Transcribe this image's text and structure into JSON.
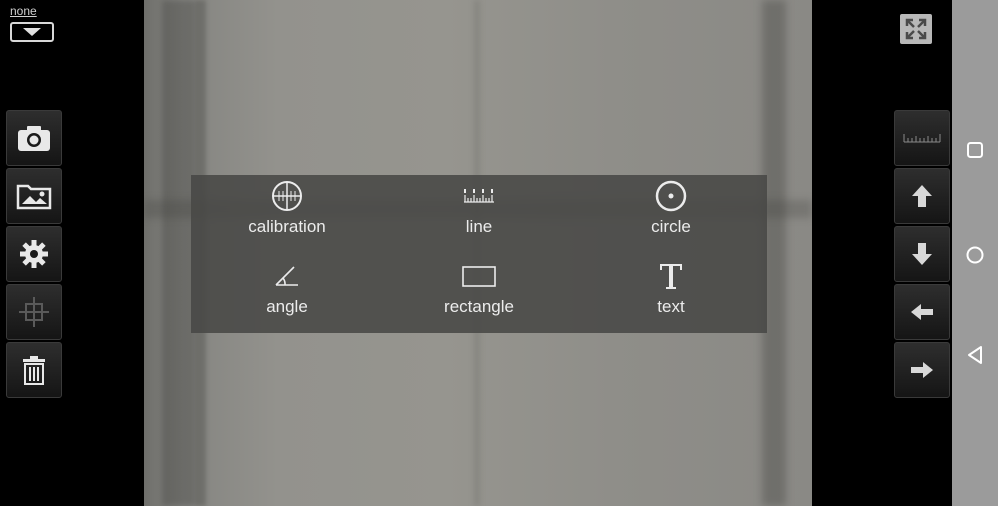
{
  "overlay": {
    "mode_label": "none"
  },
  "left_toolbar": {
    "items": [
      {
        "icon": "camera-icon"
      },
      {
        "icon": "gallery-icon"
      },
      {
        "icon": "gear-icon"
      },
      {
        "icon": "crosshair-icon"
      },
      {
        "icon": "trash-icon"
      }
    ]
  },
  "right_toolbar": {
    "items": [
      {
        "icon": "ruler-icon"
      },
      {
        "icon": "arrow-up-icon"
      },
      {
        "icon": "arrow-down-icon"
      },
      {
        "icon": "arrow-left-icon"
      },
      {
        "icon": "arrow-right-icon"
      }
    ]
  },
  "fullscreen": {
    "icon": "fullscreen-icon"
  },
  "measure_menu": {
    "items": [
      {
        "label": "calibration",
        "icon": "calibration-icon"
      },
      {
        "label": "line",
        "icon": "ruler-line-icon"
      },
      {
        "label": "circle",
        "icon": "circle-icon"
      },
      {
        "label": "angle",
        "icon": "angle-icon"
      },
      {
        "label": "rectangle",
        "icon": "rectangle-icon"
      },
      {
        "label": "text",
        "icon": "text-icon"
      }
    ]
  },
  "navbar": {
    "items": [
      {
        "icon": "square-icon"
      },
      {
        "icon": "home-circle-icon"
      },
      {
        "icon": "back-triangle-icon"
      }
    ]
  },
  "colors": {
    "menu_bg": "#484846",
    "toolbar_bg": "#1e1e1e",
    "navbar_bg": "#9b9b9b",
    "icon_light": "#e8e8e8"
  }
}
